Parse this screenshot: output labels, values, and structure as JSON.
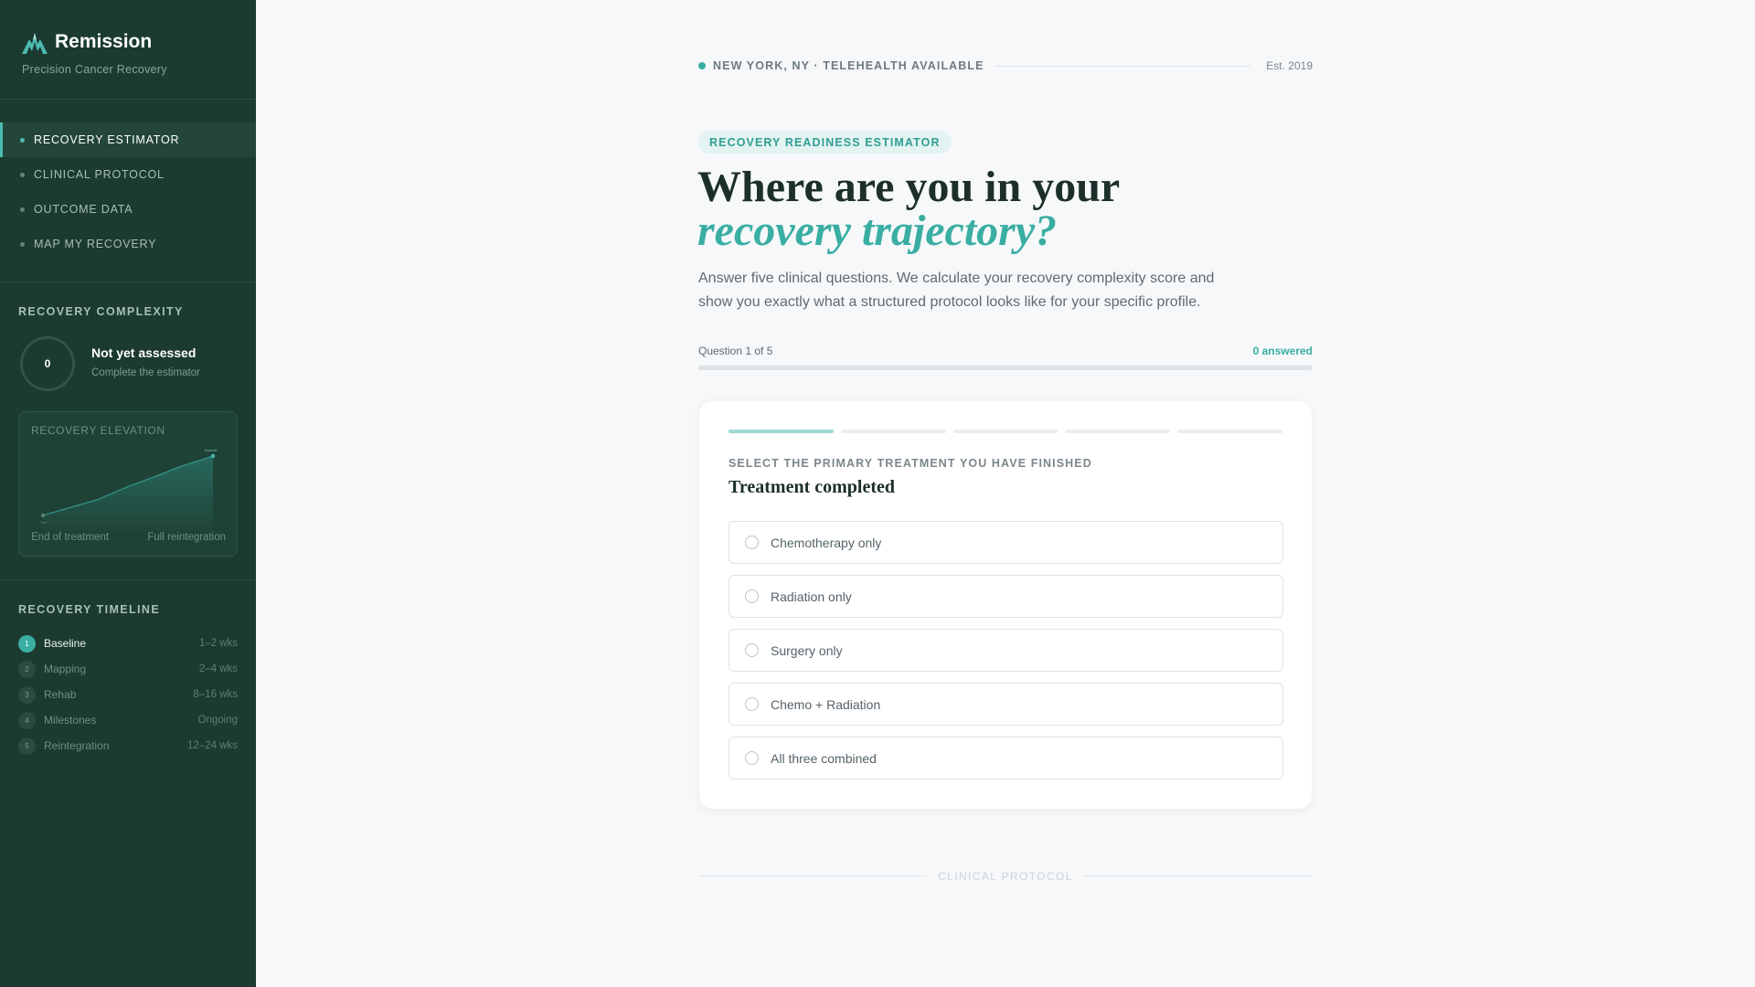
{
  "brand": {
    "name": "Remission",
    "tagline": "Precision Cancer Recovery",
    "logo_icon": "mountain-peak-icon"
  },
  "nav": [
    {
      "label": "RECOVERY ESTIMATOR",
      "active": true
    },
    {
      "label": "CLINICAL PROTOCOL",
      "active": false
    },
    {
      "label": "OUTCOME DATA",
      "active": false
    },
    {
      "label": "MAP MY RECOVERY",
      "active": false
    }
  ],
  "complexity": {
    "heading": "RECOVERY COMPLEXITY",
    "score": "0",
    "title": "Not yet assessed",
    "subtitle": "Complete the estimator"
  },
  "elevation": {
    "title": "RECOVERY ELEVATION",
    "start_label": "End of treatment",
    "end_label": "Full reintegration",
    "start_marker": "Start",
    "end_marker": "Summit"
  },
  "timeline": {
    "heading": "RECOVERY TIMELINE",
    "items": [
      {
        "num": "1",
        "name": "Baseline",
        "duration": "1–2 wks",
        "active": true
      },
      {
        "num": "2",
        "name": "Mapping",
        "duration": "2–4 wks",
        "active": false
      },
      {
        "num": "3",
        "name": "Rehab",
        "duration": "8–16 wks",
        "active": false
      },
      {
        "num": "4",
        "name": "Milestones",
        "duration": "Ongoing",
        "active": false
      },
      {
        "num": "5",
        "name": "Reintegration",
        "duration": "12–24 wks",
        "active": false
      }
    ]
  },
  "header": {
    "location": "NEW YORK, NY · TELEHEALTH AVAILABLE",
    "established": "Est. 2019"
  },
  "hero": {
    "pill": "RECOVERY READINESS ESTIMATOR",
    "title_line1": "Where are you in your",
    "title_line2": "recovery trajectory?",
    "lede": "Answer five clinical questions. We calculate your recovery complexity score and show you exactly what a structured protocol looks like for your specific profile."
  },
  "progress": {
    "label": "Question 1 of 5",
    "answered": "0 answered",
    "fraction": 0
  },
  "question": {
    "steps_total": 5,
    "step_current": 1,
    "eyebrow": "SELECT THE PRIMARY TREATMENT YOU HAVE FINISHED",
    "title": "Treatment completed",
    "options": [
      "Chemotherapy only",
      "Radiation only",
      "Surgery only",
      "Chemo + Radiation",
      "All three combined"
    ]
  },
  "section_divider": "CLINICAL PROTOCOL",
  "colors": {
    "sidebar_bg": "#1b3a30",
    "accent": "#3aaea3",
    "page_bg": "#f6f8fa"
  }
}
